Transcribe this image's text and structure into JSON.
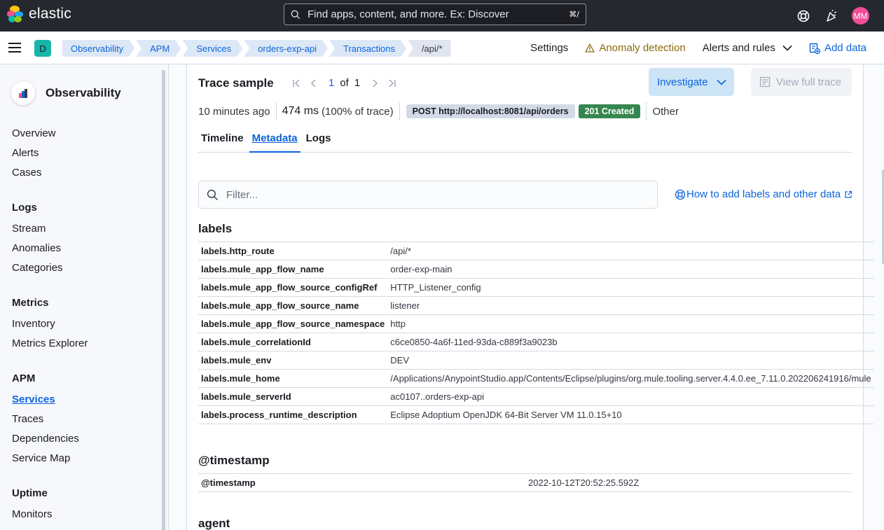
{
  "header": {
    "brand": "elastic",
    "search_placeholder": "Find apps, content, and more. Ex: Discover",
    "search_shortcut": "⌘/",
    "avatar_initials": "MM"
  },
  "navbar": {
    "space_initial": "D",
    "breadcrumbs": [
      "Observability",
      "APM",
      "Services",
      "orders-exp-api",
      "Transactions",
      "/api/*"
    ],
    "settings": "Settings",
    "anomaly": "Anomaly detection",
    "alerts": "Alerts and rules",
    "add_data": "Add data"
  },
  "sidebar": {
    "title": "Observability",
    "items": [
      "Overview",
      "Alerts",
      "Cases"
    ],
    "logs_title": "Logs",
    "logs_items": [
      "Stream",
      "Anomalies",
      "Categories"
    ],
    "metrics_title": "Metrics",
    "metrics_items": [
      "Inventory",
      "Metrics Explorer"
    ],
    "apm_title": "APM",
    "apm_items": [
      "Services",
      "Traces",
      "Dependencies",
      "Service Map"
    ],
    "uptime_title": "Uptime",
    "uptime_items": [
      "Monitors"
    ]
  },
  "trace": {
    "title": "Trace sample",
    "page_current": "1",
    "page_of": "of",
    "page_total": "1",
    "investigate": "Investigate",
    "view_full_trace": "View full trace",
    "age": "10 minutes ago",
    "duration": "474 ms",
    "duration_pct": "(100% of trace)",
    "request": "POST http://localhost:8081/api/orders",
    "status": "201 Created",
    "type": "Other"
  },
  "tabs": [
    "Timeline",
    "Metadata",
    "Logs"
  ],
  "filter_placeholder": "Filter...",
  "help_link": "How to add labels and other data",
  "sections": {
    "labels_title": "labels",
    "labels": [
      {
        "k": "labels.http_route",
        "v": "/api/*"
      },
      {
        "k": "labels.mule_app_flow_name",
        "v": "order-exp-main"
      },
      {
        "k": "labels.mule_app_flow_source_configRef",
        "v": "HTTP_Listener_config"
      },
      {
        "k": "labels.mule_app_flow_source_name",
        "v": "listener"
      },
      {
        "k": "labels.mule_app_flow_source_namespace",
        "v": "http"
      },
      {
        "k": "labels.mule_correlationId",
        "v": "c6ce0850-4a6f-11ed-93da-c889f3a9023b"
      },
      {
        "k": "labels.mule_env",
        "v": "DEV"
      },
      {
        "k": "labels.mule_home",
        "v": "/Applications/AnypointStudio.app/Contents/Eclipse/plugins/org.mule.tooling.server.4.4.0.ee_7.11.0.202206241916/mule"
      },
      {
        "k": "labels.mule_serverId",
        "v": "ac0107..orders-exp-api"
      },
      {
        "k": "labels.process_runtime_description",
        "v": "Eclipse Adoptium OpenJDK 64-Bit Server VM 11.0.15+10"
      }
    ],
    "timestamp_title": "@timestamp",
    "timestamp": [
      {
        "k": "@timestamp",
        "v": "2022-10-12T20:52:25.592Z"
      }
    ],
    "agent_title": "agent"
  }
}
